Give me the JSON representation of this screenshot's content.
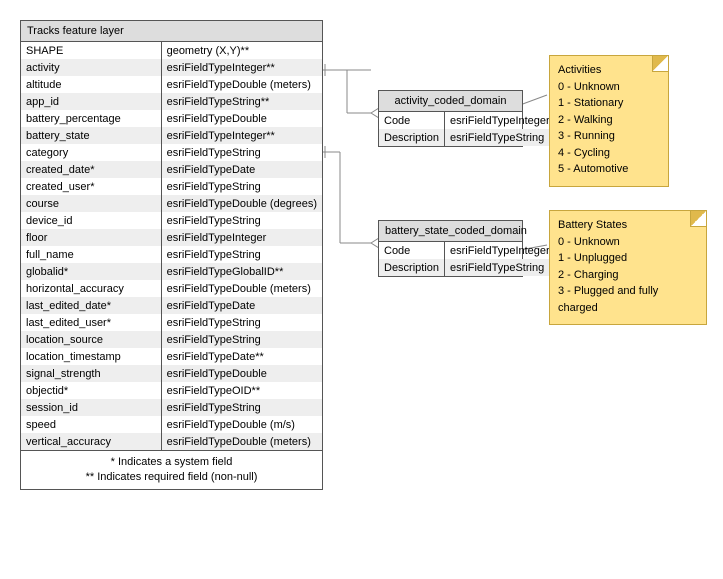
{
  "main": {
    "title": "Tracks feature layer",
    "rows": [
      {
        "name": "SHAPE",
        "type": "geometry (X,Y)**"
      },
      {
        "name": "activity",
        "type": "esriFieldTypeInteger**"
      },
      {
        "name": "altitude",
        "type": "esriFieldTypeDouble (meters)"
      },
      {
        "name": "app_id",
        "type": "esriFieldTypeString**"
      },
      {
        "name": "battery_percentage",
        "type": "esriFieldTypeDouble"
      },
      {
        "name": "battery_state",
        "type": "esriFieldTypeInteger**"
      },
      {
        "name": "category",
        "type": "esriFieldTypeString"
      },
      {
        "name": "created_date*",
        "type": "esriFieldTypeDate"
      },
      {
        "name": "created_user*",
        "type": "esriFieldTypeString"
      },
      {
        "name": "course",
        "type": "esriFieldTypeDouble (degrees)"
      },
      {
        "name": "device_id",
        "type": "esriFieldTypeString"
      },
      {
        "name": "floor",
        "type": "esriFieldTypeInteger"
      },
      {
        "name": "full_name",
        "type": "esriFieldTypeString"
      },
      {
        "name": "globalid*",
        "type": "esriFieldTypeGlobalID**"
      },
      {
        "name": "horizontal_accuracy",
        "type": "esriFieldTypeDouble (meters)"
      },
      {
        "name": "last_edited_date*",
        "type": "esriFieldTypeDate"
      },
      {
        "name": "last_edited_user*",
        "type": "esriFieldTypeString"
      },
      {
        "name": "location_source",
        "type": "esriFieldTypeString"
      },
      {
        "name": "location_timestamp",
        "type": "esriFieldTypeDate**"
      },
      {
        "name": "signal_strength",
        "type": "esriFieldTypeDouble"
      },
      {
        "name": "objectid*",
        "type": "esriFieldTypeOID**"
      },
      {
        "name": "session_id",
        "type": "esriFieldTypeString"
      },
      {
        "name": "speed",
        "type": "esriFieldTypeDouble (m/s)"
      },
      {
        "name": "vertical_accuracy",
        "type": "esriFieldTypeDouble (meters)"
      }
    ],
    "foot1": "* Indicates a system field",
    "foot2": "** Indicates required field (non-null)"
  },
  "domainA": {
    "title": "activity_coded_domain",
    "rows": [
      {
        "name": "Code",
        "type": "esriFieldTypeInteger"
      },
      {
        "name": "Description",
        "type": "esriFieldTypeString"
      }
    ]
  },
  "domainB": {
    "title": "battery_state_coded_domain",
    "rows": [
      {
        "name": "Code",
        "type": "esriFieldTypeInteger"
      },
      {
        "name": "Description",
        "type": "esriFieldTypeString"
      }
    ]
  },
  "noteA": {
    "title": "Activities",
    "lines": [
      "0 - Unknown",
      "1 - Stationary",
      "2 - Walking",
      "3 - Running",
      "4 - Cycling",
      "5 - Automotive"
    ]
  },
  "noteB": {
    "title": "Battery States",
    "lines": [
      "0 - Unknown",
      "1 - Unplugged",
      "2 - Charging",
      "3 - Plugged and fully charged"
    ]
  }
}
